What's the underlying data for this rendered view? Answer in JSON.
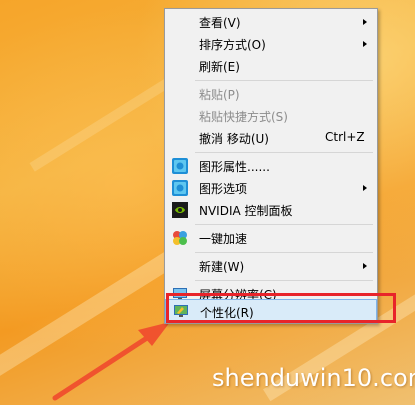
{
  "context_menu": {
    "items": [
      {
        "label": "查看(V)",
        "submenu": true
      },
      {
        "label": "排序方式(O)",
        "submenu": true
      },
      {
        "label": "刷新(E)"
      },
      {
        "label": "粘贴(P)",
        "disabled": true
      },
      {
        "label": "粘贴快捷方式(S)",
        "disabled": true
      },
      {
        "label": "撤消 移动(U)",
        "shortcut": "Ctrl+Z"
      },
      {
        "label": "图形属性......",
        "icon": "intel-graphics-icon"
      },
      {
        "label": "图形选项",
        "icon": "intel-graphics-icon",
        "submenu": true
      },
      {
        "label": "NVIDIA 控制面板",
        "icon": "nvidia-icon"
      },
      {
        "label": "一键加速",
        "icon": "speedup-icon"
      },
      {
        "label": "新建(W)",
        "submenu": true
      },
      {
        "label": "屏幕分辨率(C)",
        "icon": "monitor-icon"
      },
      {
        "label": "个性化(R)",
        "icon": "personalize-icon",
        "highlighted": true
      }
    ]
  },
  "watermark": "shenduwin10.com",
  "colors": {
    "highlight_box": "#e8242a",
    "annotation_arrow": "#f0532e",
    "desktop_orange": "#f6a52a"
  }
}
